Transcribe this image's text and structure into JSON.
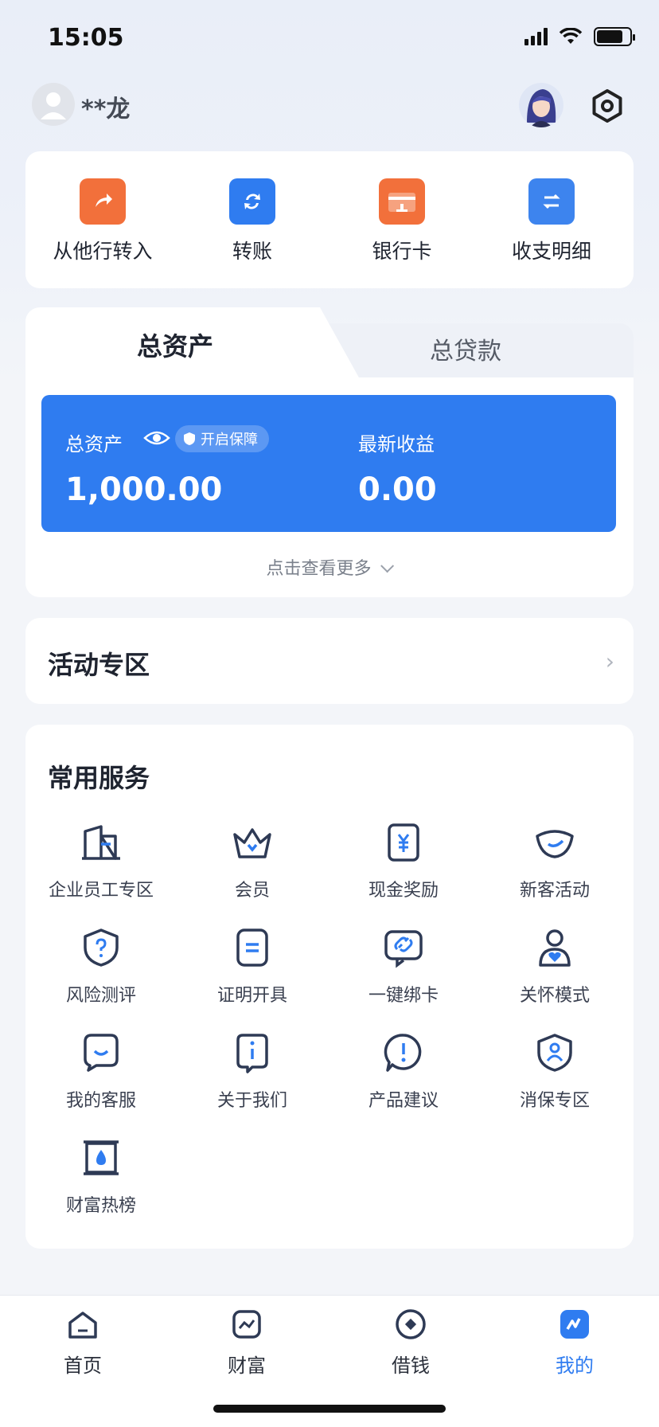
{
  "status_bar": {
    "time": "15:05"
  },
  "header": {
    "username": "**龙"
  },
  "quick_actions": [
    {
      "label": "从他行转入",
      "icon": "transfer-in-icon",
      "color": "#f2703b"
    },
    {
      "label": "转账",
      "icon": "transfer-icon",
      "color": "#2f7cf0"
    },
    {
      "label": "银行卡",
      "icon": "bank-card-icon",
      "color": "#f2703b"
    },
    {
      "label": "收支明细",
      "icon": "statement-icon",
      "color": "#3d84ee"
    }
  ],
  "assets": {
    "tab_total_assets": "总资产",
    "tab_total_loans": "总贷款",
    "total_label": "总资产",
    "protect_badge": "开启保障",
    "total_value": "1,000.00",
    "income_label": "最新收益",
    "income_value": "0.00",
    "see_more": "点击查看更多"
  },
  "activity": {
    "title": "活动专区"
  },
  "services": {
    "title": "常用服务",
    "items": [
      {
        "label": "企业员工专区",
        "icon": "building-icon"
      },
      {
        "label": "会员",
        "icon": "crown-icon"
      },
      {
        "label": "现金奖励",
        "icon": "cash-reward-icon"
      },
      {
        "label": "新客活动",
        "icon": "gold-ingot-icon"
      },
      {
        "label": "风险测评",
        "icon": "risk-shield-icon"
      },
      {
        "label": "证明开具",
        "icon": "document-icon"
      },
      {
        "label": "一键绑卡",
        "icon": "link-card-icon"
      },
      {
        "label": "关怀模式",
        "icon": "care-person-icon"
      },
      {
        "label": "我的客服",
        "icon": "customer-service-icon"
      },
      {
        "label": "关于我们",
        "icon": "info-icon"
      },
      {
        "label": "产品建议",
        "icon": "suggestion-icon"
      },
      {
        "label": "消保专区",
        "icon": "consumer-protection-icon"
      },
      {
        "label": "财富热榜",
        "icon": "wealth-ranking-icon"
      }
    ]
  },
  "tabbar": [
    {
      "label": "首页",
      "icon": "home-icon"
    },
    {
      "label": "财富",
      "icon": "wealth-icon"
    },
    {
      "label": "借钱",
      "icon": "borrow-icon"
    },
    {
      "label": "我的",
      "icon": "mine-icon",
      "active": true
    }
  ],
  "colors": {
    "accent": "#2f7cf0",
    "orange": "#f2703b"
  }
}
